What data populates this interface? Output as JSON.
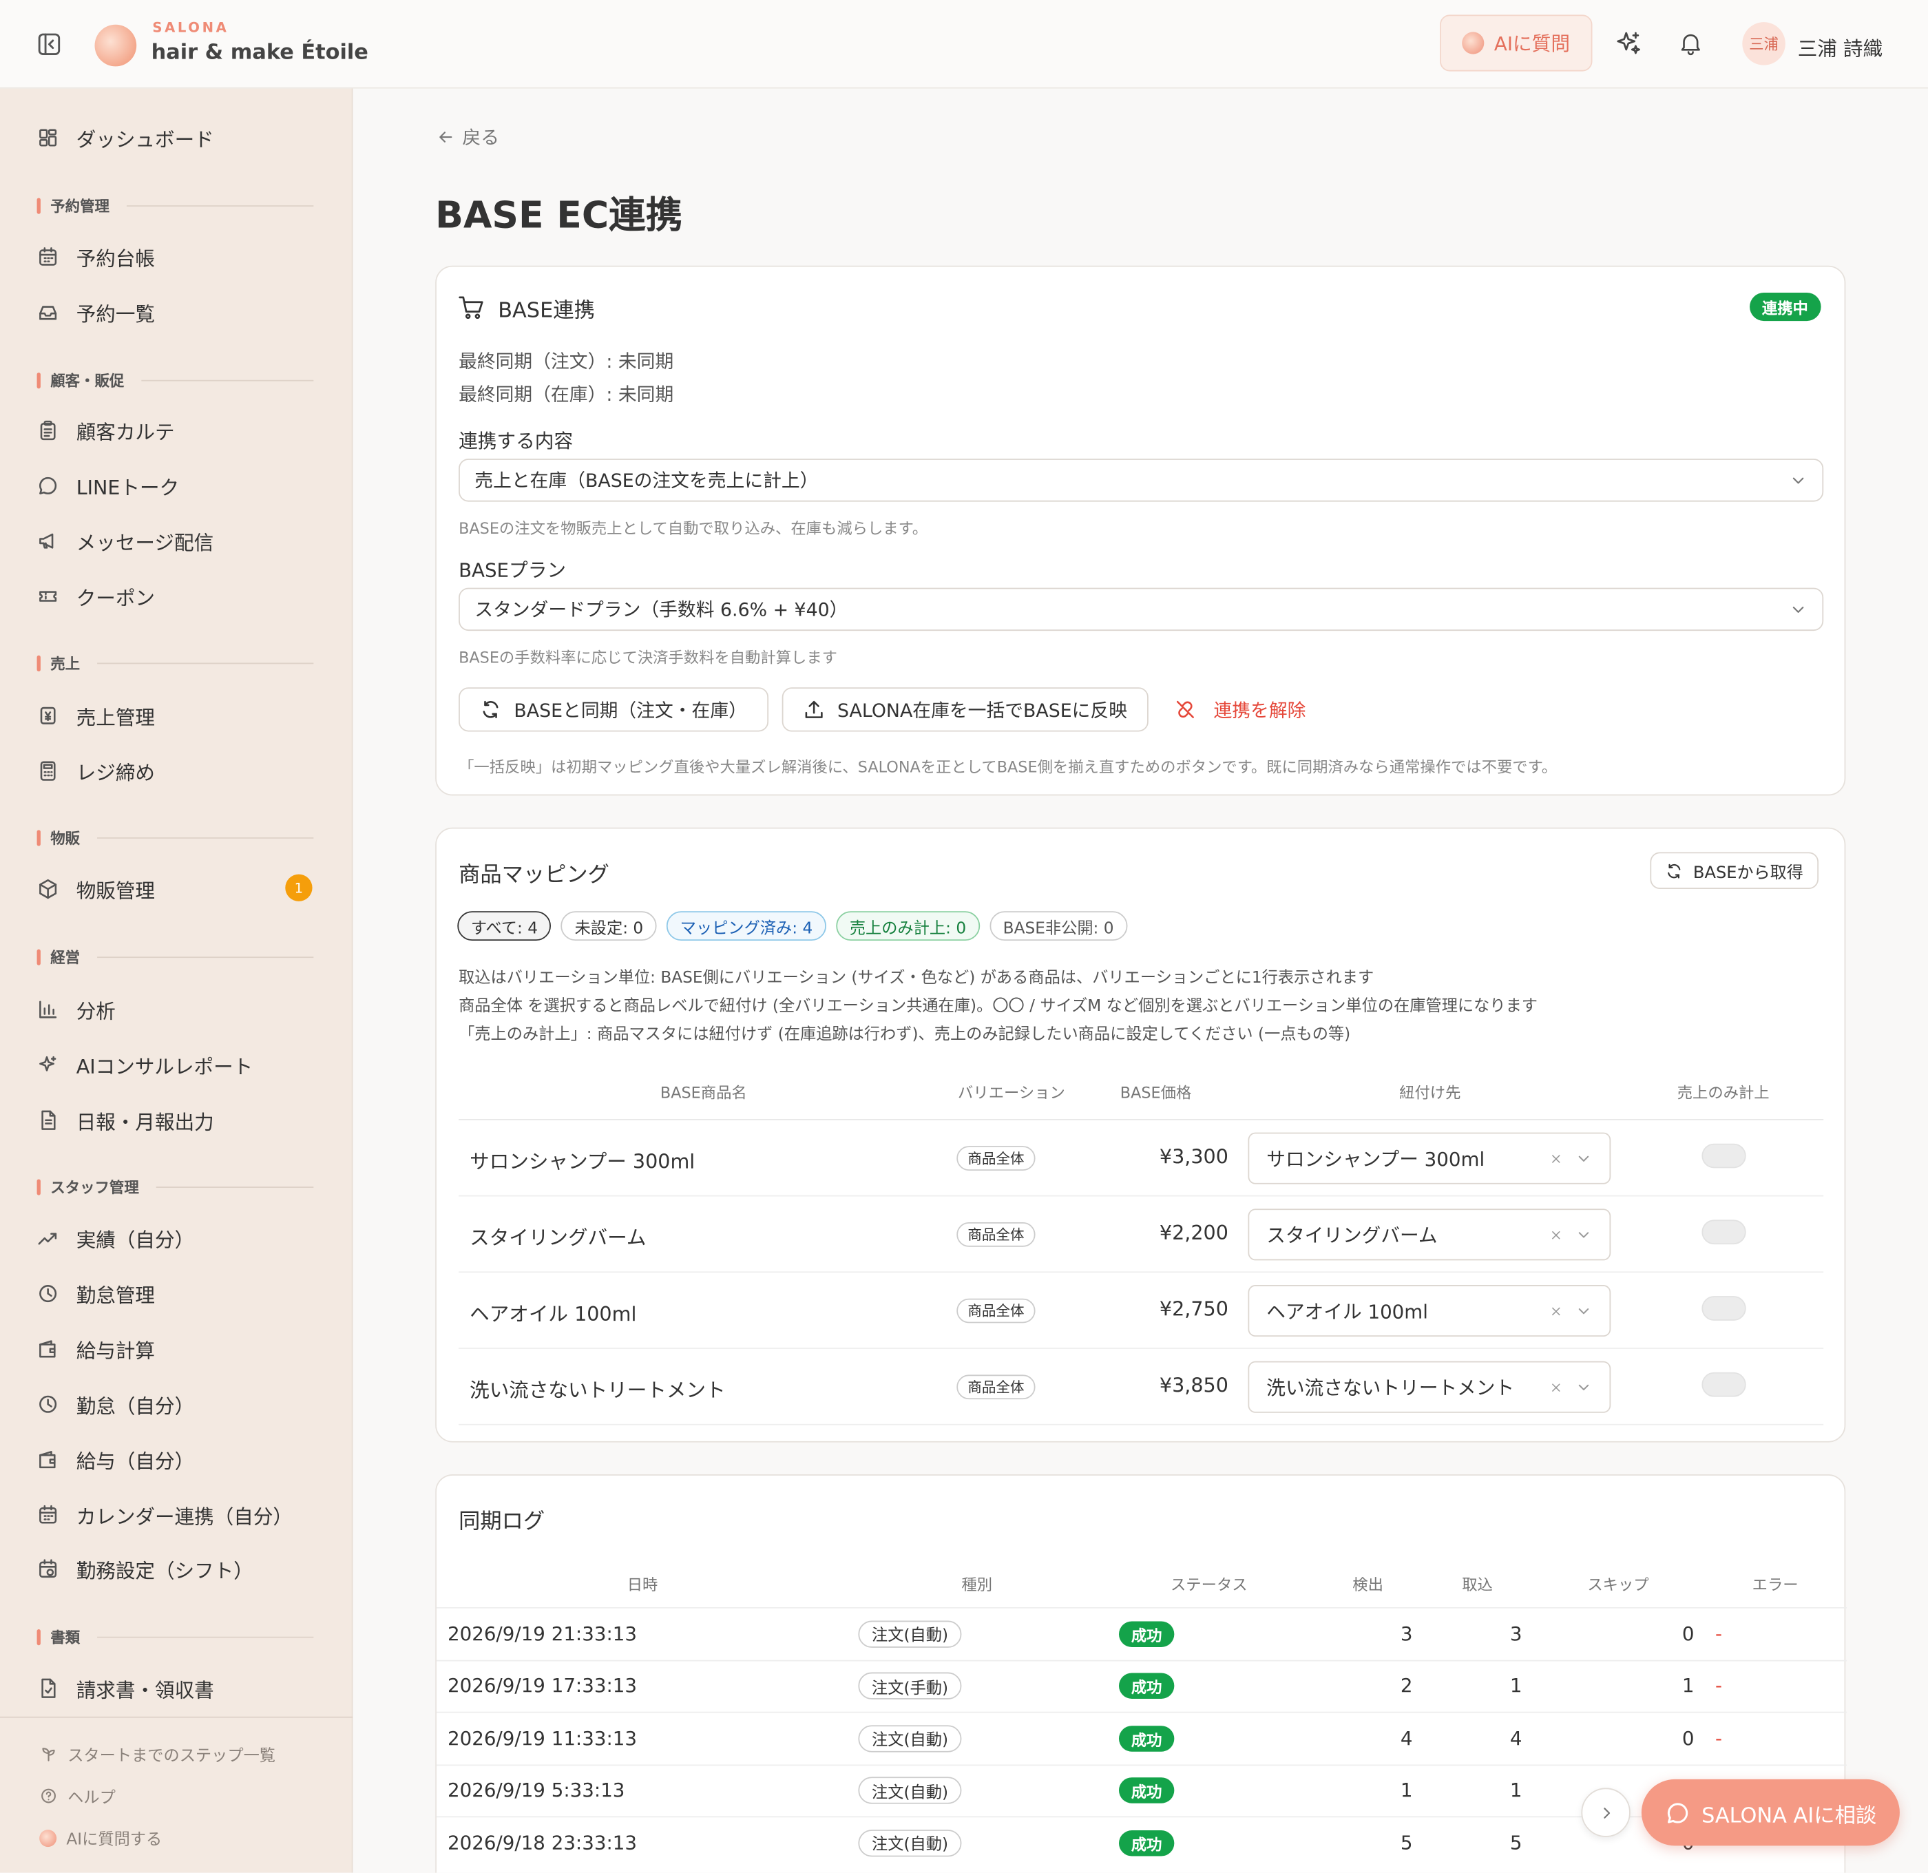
{
  "app": {
    "brand": "SALONA",
    "shop": "hair & make Étoile"
  },
  "topbar": {
    "ai_button": "AIに質問",
    "avatar": "三浦",
    "user": "三浦 詩織"
  },
  "sidebar": {
    "dashboard": "ダッシュボード",
    "sections": [
      "予約管理",
      "顧客・販促",
      "売上",
      "物販",
      "経営",
      "スタッフ管理",
      "書類"
    ],
    "items": [
      "予約台帳",
      "予約一覧",
      "顧客カルテ",
      "LINEトーク",
      "メッセージ配信",
      "クーポン",
      "売上管理",
      "レジ締め",
      "物販管理",
      "分析",
      "AIコンサルレポート",
      "日報・月報出力",
      "実績（自分）",
      "勤怠管理",
      "給与計算",
      "勤怠（自分）",
      "給与（自分）",
      "カレンダー連携（自分）",
      "勤務設定（シフト）",
      "請求書・領収書"
    ],
    "badge": "1",
    "footer": [
      "スタートまでのステップ一覧",
      "ヘルプ",
      "AIに質問する"
    ]
  },
  "page": {
    "back": "戻る",
    "title": "BASE EC連携"
  },
  "base": {
    "title": "BASE連携",
    "status": "連携中",
    "last_order": "最終同期（注文）: 未同期",
    "last_stock": "最終同期（在庫）: 未同期",
    "content_label": "連携する内容",
    "content_value": "売上と在庫（BASEの注文を売上に計上）",
    "content_help": "BASEの注文を物販売上として自動で取り込み、在庫も減らします。",
    "plan_label": "BASEプラン",
    "plan_value": "スタンダードプラン（手数料 6.6% + ¥40）",
    "plan_help": "BASEの手数料率に応じて決済手数料を自動計算します",
    "sync_button": "BASEと同期（注文・在庫）",
    "push_button": "SALONA在庫を一括でBASEに反映",
    "unlink_button": "連携を解除",
    "note": "「一括反映」は初期マッピング直後や大量ズレ解消後に、SALONAを正としてBASE側を揃え直すためのボタンです。既に同期済みなら通常操作では不要です。"
  },
  "mapping": {
    "title": "商品マッピング",
    "fetch_button": "BASEから取得",
    "filters": [
      "すべて: 4",
      "未設定: 0",
      "マッピング済み: 4",
      "売上のみ計上: 0",
      "BASE非公開: 0"
    ],
    "info": [
      "取込はバリエーション単位: BASE側にバリエーション (サイズ・色など) がある商品は、バリエーションごとに1行表示されます",
      "商品全体 を選択すると商品レベルで紐付け (全バリエーション共通在庫)。〇〇 / サイズM など個別を選ぶとバリエーション単位の在庫管理になります",
      "「売上のみ計上」: 商品マスタには紐付けず (在庫追跡は行わず)、売上のみ記録したい商品に設定してください (一点もの等)"
    ],
    "headers": [
      "BASE商品名",
      "バリエーション",
      "BASE価格",
      "紐付け先",
      "売上のみ計上"
    ],
    "rows": [
      {
        "name": "サロンシャンプー 300ml",
        "variation": "商品全体",
        "price": "¥3,300",
        "target": "サロンシャンプー 300ml"
      },
      {
        "name": "スタイリングバーム",
        "variation": "商品全体",
        "price": "¥2,200",
        "target": "スタイリングバーム"
      },
      {
        "name": "ヘアオイル 100ml",
        "variation": "商品全体",
        "price": "¥2,750",
        "target": "ヘアオイル 100ml"
      },
      {
        "name": "洗い流さないトリートメント",
        "variation": "商品全体",
        "price": "¥3,850",
        "target": "洗い流さないトリートメント"
      }
    ]
  },
  "log": {
    "title": "同期ログ",
    "headers": [
      "日時",
      "種別",
      "ステータス",
      "検出",
      "取込",
      "スキップ",
      "エラー"
    ],
    "rows": [
      {
        "time": "2026/9/19 21:33:13",
        "type": "注文(自動)",
        "status": "成功",
        "detected": "3",
        "imported": "3",
        "skipped": "0",
        "error": "-"
      },
      {
        "time": "2026/9/19 17:33:13",
        "type": "注文(手動)",
        "status": "成功",
        "detected": "2",
        "imported": "1",
        "skipped": "1",
        "error": "-"
      },
      {
        "time": "2026/9/19 11:33:13",
        "type": "注文(自動)",
        "status": "成功",
        "detected": "4",
        "imported": "4",
        "skipped": "0",
        "error": "-"
      },
      {
        "time": "2026/9/19 5:33:13",
        "type": "注文(自動)",
        "status": "成功",
        "detected": "1",
        "imported": "1",
        "skipped": "",
        "error": ""
      },
      {
        "time": "2026/9/18 23:33:13",
        "type": "注文(自動)",
        "status": "成功",
        "detected": "5",
        "imported": "5",
        "skipped": "0",
        "error": ""
      }
    ]
  },
  "fab": {
    "label": "SALONA AIに相談"
  }
}
